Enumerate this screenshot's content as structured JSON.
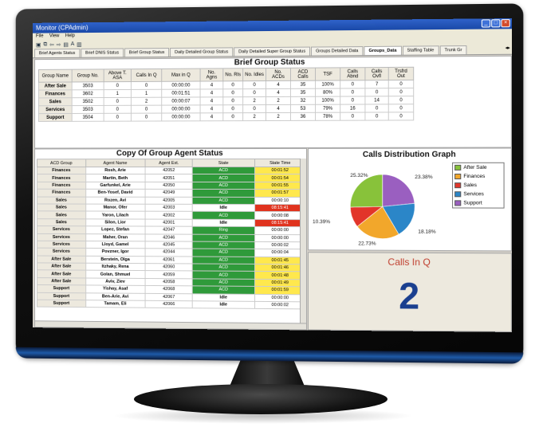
{
  "window": {
    "title": "Monitor (CPAdmin)"
  },
  "menu": [
    "File",
    "View",
    "Help"
  ],
  "tabs": [
    {
      "label": "Brief Agents Status",
      "active": false
    },
    {
      "label": "Brief DNIS Status",
      "active": false
    },
    {
      "label": "Brief Group Status",
      "active": false
    },
    {
      "label": "Daily Detailed Group Status",
      "active": false
    },
    {
      "label": "Daily Detailed Super Group Status",
      "active": false
    },
    {
      "label": "Groups Detailed Data",
      "active": false
    },
    {
      "label": "Groups_Data",
      "active": true
    },
    {
      "label": "Staffing Table",
      "active": false
    },
    {
      "label": "Trunk Gr",
      "active": false
    }
  ],
  "brief": {
    "title": "Brief Group Status",
    "headers": [
      "Group Name",
      "Group No.",
      "Above T. ASA",
      "Calls In Q",
      "Max in Q",
      "No. Agns",
      "No. Rls",
      "No. Idles",
      "No. ACDs",
      "ACD Calls",
      "TSF",
      "Calls Abnd",
      "Calls Ovfl",
      "Trsfrd Out"
    ],
    "rows": [
      [
        "After Sale",
        "3503",
        "0",
        "0",
        "00:00:00",
        "4",
        "0",
        "0",
        "4",
        "35",
        "100%",
        "0",
        "7",
        "0"
      ],
      [
        "Finances",
        "3602",
        "1",
        "1",
        "00:01:51",
        "4",
        "0",
        "0",
        "4",
        "35",
        "80%",
        "0",
        "0",
        "0"
      ],
      [
        "Sales",
        "3502",
        "0",
        "2",
        "00:00:07",
        "4",
        "0",
        "2",
        "2",
        "32",
        "100%",
        "0",
        "14",
        "0"
      ],
      [
        "Services",
        "3503",
        "0",
        "0",
        "00:00:00",
        "4",
        "0",
        "0",
        "4",
        "53",
        "79%",
        "16",
        "0",
        "0"
      ],
      [
        "Support",
        "3504",
        "0",
        "0",
        "00:00:00",
        "4",
        "0",
        "2",
        "2",
        "36",
        "78%",
        "0",
        "0",
        "0"
      ]
    ]
  },
  "agents": {
    "title": "Copy Of Group Agent Status",
    "headers": [
      "ACD Group",
      "Agent Name",
      "Agent Ext.",
      "State",
      "State Time"
    ],
    "rows": [
      [
        "Finances",
        "Rosh, Arie",
        "42052",
        "ACD",
        "00:01:52"
      ],
      [
        "Finances",
        "Martin, Beth",
        "42051",
        "ACD",
        "00:01:54"
      ],
      [
        "Finances",
        "Garfunkel, Arie",
        "42050",
        "ACD",
        "00:01:55"
      ],
      [
        "Finances",
        "Ben-Yosef, David",
        "42049",
        "ACD",
        "00:01:57"
      ],
      [
        "Sales",
        "Rozen, Avi",
        "42005",
        "ACD",
        "00:00:10"
      ],
      [
        "Sales",
        "Manor, Ofer",
        "42003",
        "Idle",
        "08:15:41"
      ],
      [
        "Sales",
        "Yaron, Lilach",
        "42002",
        "ACD",
        "00:00:08"
      ],
      [
        "Sales",
        "Silon, Lior",
        "42001",
        "Idle",
        "08:15:41"
      ],
      [
        "Services",
        "Lopez, Stefan",
        "42047",
        "Ring",
        "00:00:00"
      ],
      [
        "Services",
        "Maher, Oran",
        "42046",
        "ACD",
        "00:00:00"
      ],
      [
        "Services",
        "Lloyd, Gamel",
        "42045",
        "ACD",
        "00:00:02"
      ],
      [
        "Services",
        "Povzner, Igor",
        "42044",
        "ACD",
        "00:00:04"
      ],
      [
        "After Sale",
        "Berstein, Olga",
        "42061",
        "ACD",
        "00:01:45"
      ],
      [
        "After Sale",
        "Itzhaky, Rena",
        "42060",
        "ACD",
        "00:01:46"
      ],
      [
        "After Sale",
        "Golan, Shmuel",
        "42059",
        "ACD",
        "00:01:48"
      ],
      [
        "After Sale",
        "Aviv, Ziev",
        "42058",
        "ACD",
        "00:01:49"
      ],
      [
        "Support",
        "Yishay, Asaf",
        "42068",
        "ACD",
        "00:01:59"
      ],
      [
        "Support",
        "Ben-Arie, Avi",
        "42067",
        "Idle",
        "00:00:00"
      ],
      [
        "Support",
        "Tamam, Eli",
        "42066",
        "Idle",
        "00:00:02"
      ]
    ],
    "time_colors": [
      "y",
      "y",
      "y",
      "y",
      "w",
      "r",
      "w",
      "r",
      "w",
      "w",
      "w",
      "w",
      "y",
      "y",
      "y",
      "y",
      "y",
      "w",
      "w"
    ]
  },
  "pie": {
    "title": "Calls Distribution Graph",
    "labels": [
      "25.32%",
      "23.38%",
      "18.18%",
      "22.73%",
      "10.39%"
    ],
    "legend": [
      "After Sale",
      "Finances",
      "Sales",
      "Services",
      "Support"
    ],
    "colors": {
      "after_sale": "#88c23a",
      "finances": "#f2a72b",
      "sales": "#e2352a",
      "services": "#2b86c8",
      "support": "#9a5fc0"
    }
  },
  "calls_in_q": {
    "title": "Calls In Q",
    "value": "2"
  }
}
